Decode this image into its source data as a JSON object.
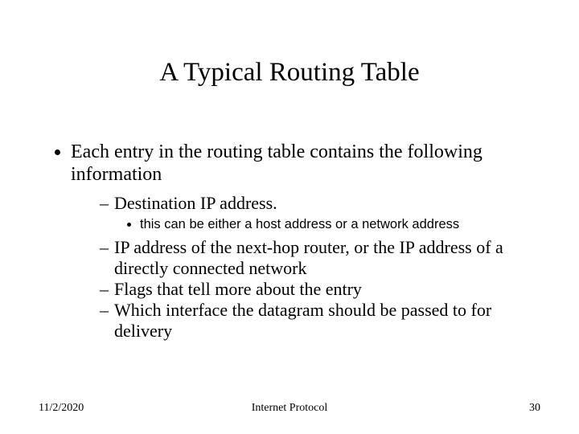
{
  "title": "A Typical Routing Table",
  "bullets": {
    "main": "Each entry in the routing table contains the following information",
    "subs": {
      "a": "Destination IP address.",
      "a_note": "this can be either a host address or a network address",
      "b": "IP address of the next-hop router, or the IP address of a directly connected network",
      "c": "Flags that tell more about the entry",
      "d": "Which interface the datagram should be passed to for delivery"
    }
  },
  "footer": {
    "date": "11/2/2020",
    "subject": "Internet Protocol",
    "page": "30"
  }
}
